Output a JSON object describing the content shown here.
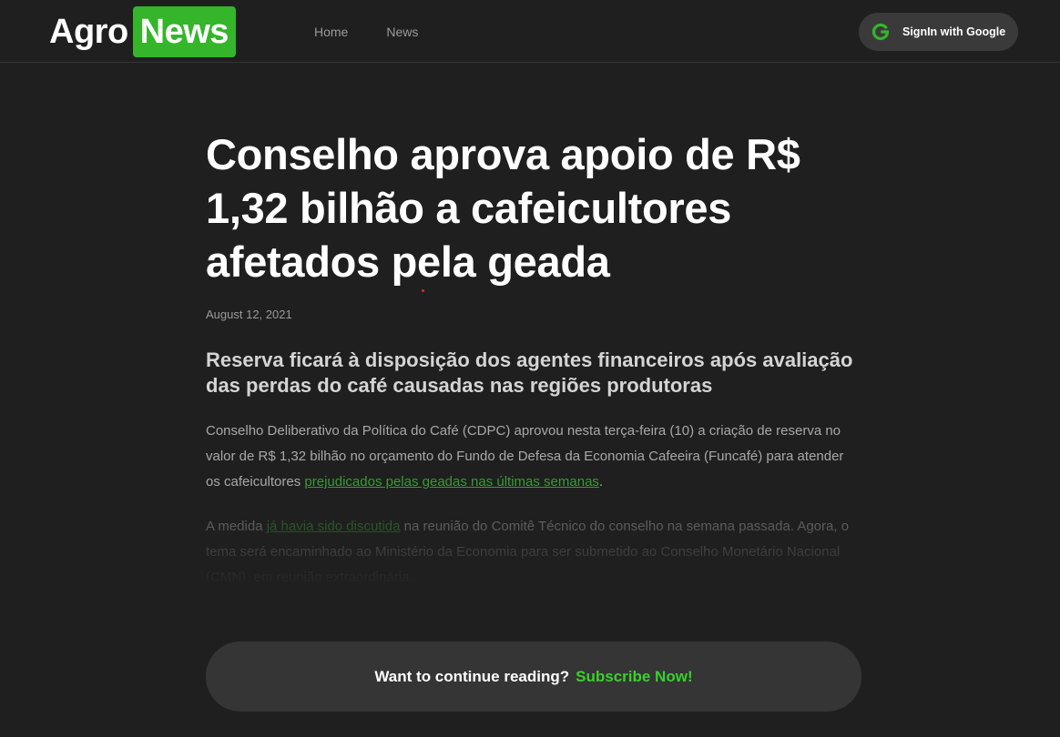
{
  "brand": {
    "part1": "Agro",
    "part2": "News",
    "accent_color": "#34b52a"
  },
  "nav": {
    "items": [
      {
        "label": "Home"
      },
      {
        "label": "News"
      }
    ]
  },
  "auth": {
    "icon": "google-g-icon",
    "label": "SignIn with Google"
  },
  "article": {
    "title": "Conselho aprova apoio de R$ 1,32 bilhão a cafeicultores afetados pela geada",
    "date": "August 12, 2021",
    "subtitle": "Reserva ficará à disposição dos agentes financeiros após avaliação das perdas do café causadas nas regiões produtoras",
    "paragraph1": {
      "before_link": "Conselho Deliberativo da Política do Café (CDPC) aprovou nesta terça-feira (10) a criação de reserva no valor de R$ 1,32 bilhão no orçamento do Fundo de Defesa da Economia Cafeeira (Funcafé) para atender os cafeicultores ",
      "link": "prejudicados pelas geadas nas últimas semanas",
      "after_link": "."
    },
    "paragraph2": {
      "before_link": "A medida ",
      "link": "já havia sido discutida",
      "after_link": " na reunião do Comitê Técnico do conselho na semana passada. Agora, o tema será encaminhado ao Ministério da Economia para ser submetido ao Conselho Monetário Nacional (CMN), em reunião extraordinária."
    }
  },
  "paywall": {
    "prompt": "Want to continue reading?",
    "cta": "Subscribe Now!",
    "cta_color": "#39d12c"
  }
}
